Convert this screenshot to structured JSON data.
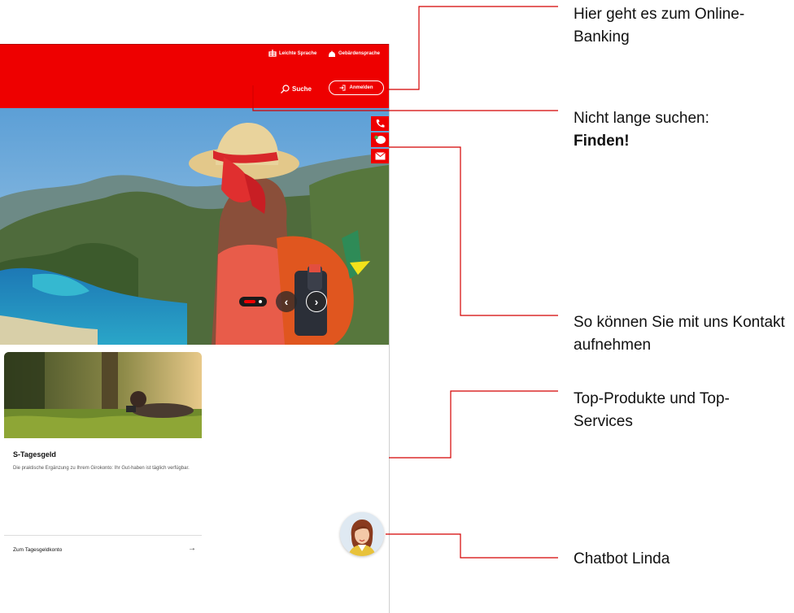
{
  "header": {
    "utility_links": [
      "Leichte Sprache",
      "Gebärdensprache"
    ],
    "search_label": "Suche",
    "login_label": "Anmelden"
  },
  "hero": {
    "slider_prev": "‹",
    "slider_next": "›"
  },
  "card": {
    "title": "S-Tagesgeld",
    "text": "Die praktische Ergänzung zu Ihrem Girokonto: Ihr Gut-haben ist täglich verfügbar.",
    "link": "Zum Tagesgeldkonto",
    "arrow": "→"
  },
  "callouts": {
    "online_banking": "Hier geht es zum Online-Banking",
    "search_line1": "Nicht lange suchen:",
    "search_line2": "Finden!",
    "contact": "So können Sie mit uns Kontakt aufnehmen",
    "products": "Top-Produkte und Top-Services",
    "chatbot": "Chatbot Linda"
  },
  "colors": {
    "brand_red": "#ee0000",
    "callout_line": "#d40000"
  }
}
